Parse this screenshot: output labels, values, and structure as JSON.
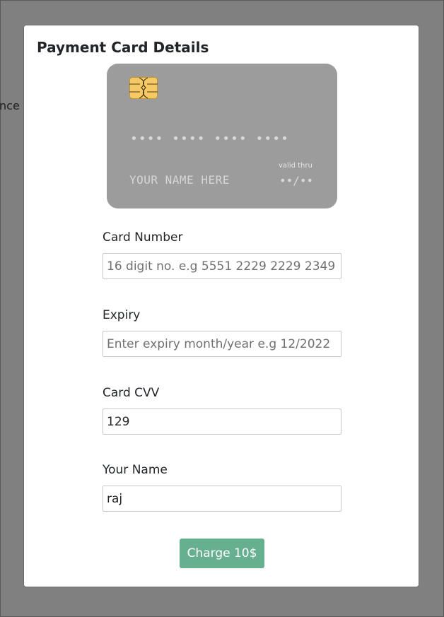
{
  "background": {
    "partial_label": "nce :"
  },
  "modal": {
    "title": "Payment Card Details",
    "card_preview": {
      "number_mask": "•••• •••• •••• ••••",
      "name_placeholder": "YOUR NAME HERE",
      "valid_thru_label": "valid thru",
      "expiry_mask": "••/••"
    },
    "fields": {
      "card_number": {
        "label": "Card Number",
        "value": "",
        "placeholder": "16 digit no. e.g 5551 2229 2229 2349"
      },
      "expiry": {
        "label": "Expiry",
        "value": "",
        "placeholder": "Enter expiry month/year e.g 12/2022"
      },
      "cvv": {
        "label": "Card CVV",
        "value": "129",
        "placeholder": ""
      },
      "name": {
        "label": "Your Name",
        "value": "raj",
        "placeholder": ""
      }
    },
    "charge_button": "Charge 10$"
  },
  "colors": {
    "overlay": "#808080",
    "card_bg": "#9c9c9c",
    "chip": "#f5c965",
    "button": "#66b08f"
  }
}
